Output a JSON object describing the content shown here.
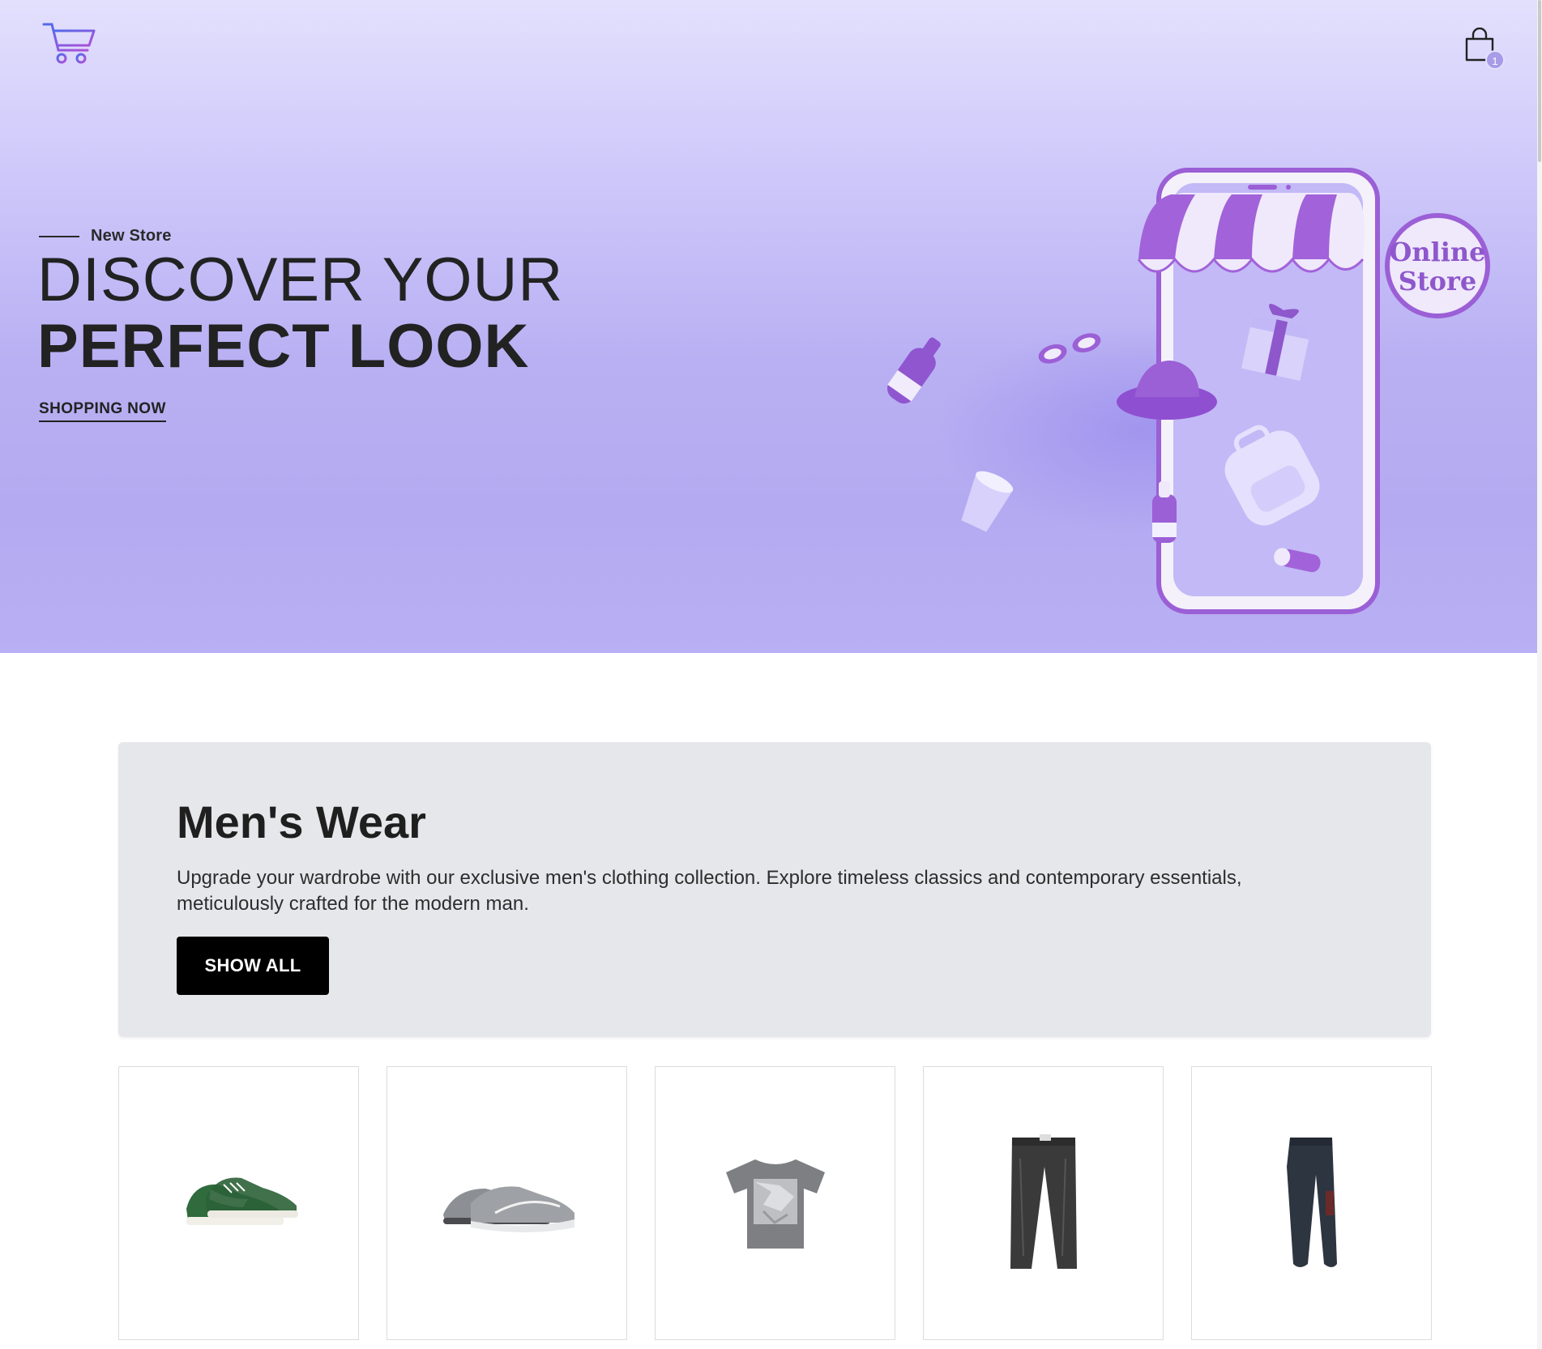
{
  "header": {
    "logo_icon": "shopping-cart-logo-icon",
    "cart_icon": "shopping-bag-icon",
    "cart_count": "1"
  },
  "hero": {
    "eyebrow": "New Store",
    "title_line1": "DISCOVER YOUR",
    "title_line2": "PERFECT LOOK",
    "cta_label": "SHOPPING NOW",
    "illustration_sign": [
      "Online",
      "Store"
    ],
    "colors": {
      "background": "#c6befa",
      "accent": "#9b5fd6"
    }
  },
  "category": {
    "title": "Men's Wear",
    "description": "Upgrade your wardrobe with our exclusive men's clothing collection. Explore timeless classics and contemporary essentials, meticulously crafted for the modern man.",
    "button_label": "SHOW ALL"
  },
  "products": [
    {
      "image": "green-sneakers"
    },
    {
      "image": "grey-running-shoes"
    },
    {
      "image": "grey-graphic-tshirt"
    },
    {
      "image": "dark-wash-jeans"
    },
    {
      "image": "dark-track-pants"
    }
  ]
}
